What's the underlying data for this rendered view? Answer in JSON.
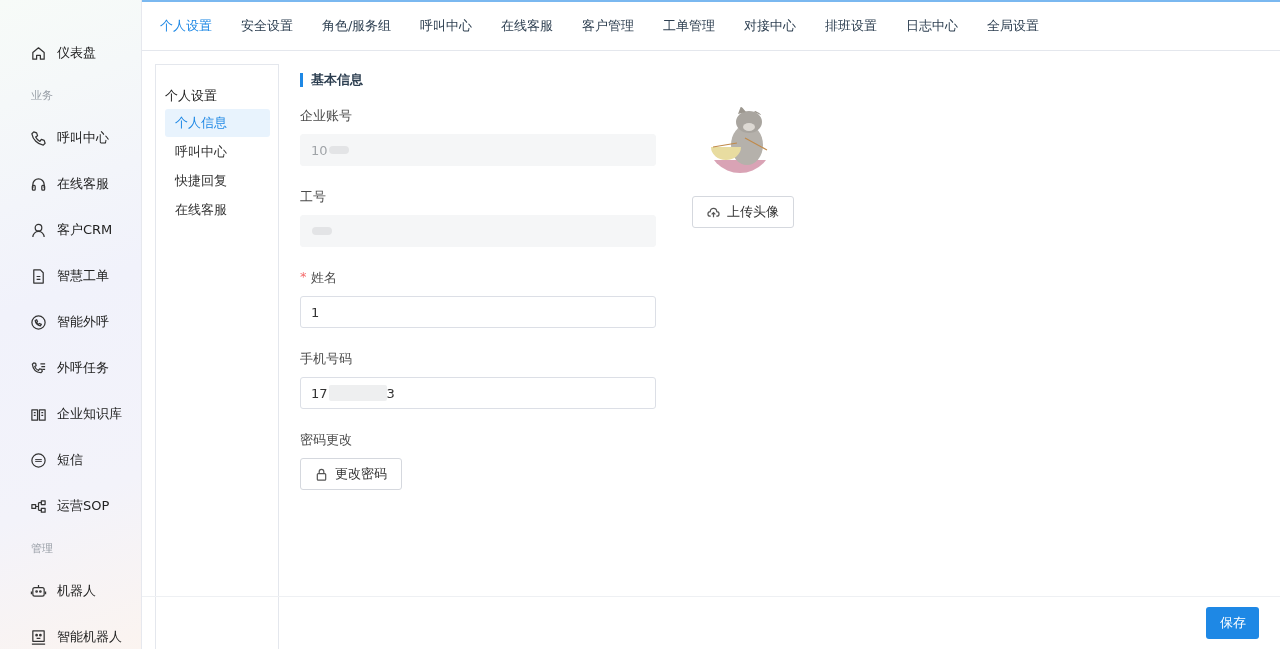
{
  "sidebar": {
    "sections": [
      {
        "items": [
          {
            "label": "仪表盘"
          }
        ]
      },
      {
        "title": "业务",
        "items": [
          {
            "label": "呼叫中心"
          },
          {
            "label": "在线客服"
          },
          {
            "label": "客户CRM"
          },
          {
            "label": "智慧工单"
          },
          {
            "label": "智能外呼"
          },
          {
            "label": "外呼任务"
          },
          {
            "label": "企业知识库"
          },
          {
            "label": "短信"
          },
          {
            "label": "运营SOP"
          }
        ]
      },
      {
        "title": "管理",
        "items": [
          {
            "label": "机器人"
          },
          {
            "label": "智能机器人"
          }
        ]
      }
    ]
  },
  "tabs": [
    {
      "label": "个人设置",
      "selected": true
    },
    {
      "label": "安全设置",
      "selected": false
    },
    {
      "label": "角色/服务组",
      "selected": false
    },
    {
      "label": "呼叫中心",
      "selected": false
    },
    {
      "label": "在线客服",
      "selected": false
    },
    {
      "label": "客户管理",
      "selected": false
    },
    {
      "label": "工单管理",
      "selected": false
    },
    {
      "label": "对接中心",
      "selected": false
    },
    {
      "label": "排班设置",
      "selected": false
    },
    {
      "label": "日志中心",
      "selected": false
    },
    {
      "label": "全局设置",
      "selected": false
    }
  ],
  "subnav": {
    "title": "个人设置",
    "items": [
      {
        "label": "个人信息",
        "selected": true
      },
      {
        "label": "呼叫中心",
        "selected": false
      },
      {
        "label": "快捷回复",
        "selected": false
      },
      {
        "label": "在线客服",
        "selected": false
      }
    ]
  },
  "section_title": "基本信息",
  "fields": [
    {
      "label": "企业账号",
      "value": "10",
      "disabled": true,
      "redacted": true
    },
    {
      "label": "工号",
      "disabled": true,
      "redacted": true
    },
    {
      "label": "姓名",
      "required_mark": "*",
      "value": "1",
      "disabled": false,
      "redacted": false
    },
    {
      "label": "手机号码",
      "value": "17",
      "value_end": "3",
      "disabled": false,
      "redacted": true
    }
  ],
  "password": {
    "label": "密码更改",
    "button": "更改密码"
  },
  "avatar": {
    "kind": "picture",
    "upload_button": "上传头像"
  },
  "save_button": "保存"
}
